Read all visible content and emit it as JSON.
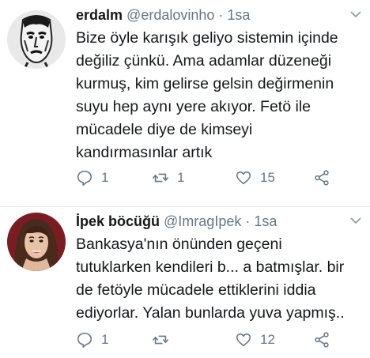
{
  "tweets": [
    {
      "display_name": "erdalm",
      "handle": "@erdalovinho",
      "separator": "·",
      "time": "1sa",
      "text": "Bize öyle karışık geliyo sistemin içinde\ndeğiliz çünkü. Ama adamlar düzeneği\nkurmuş, kim gelirse gelsin değirmenin\nsuyu hep aynı yere akıyor. Fetö ile\nmücadele diye de kimseyi\nkandırmasınlar artık",
      "replies": "1",
      "retweets": "1",
      "likes": "15"
    },
    {
      "display_name": "İpek böcüğü",
      "handle": "@ImragIpek",
      "separator": "·",
      "time": "1sa",
      "text": "Bankasya'nın önünden geçeni\ntutuklarken kendileri b... a batmışlar.  bir\nde fetöyle mücadele ettiklerini iddia\nediyorlar. Yalan bunlarda yuva yapmış..",
      "replies": "1",
      "retweets": "",
      "likes": "12"
    }
  ],
  "icons": {
    "reply": "reply-icon",
    "retweet": "retweet-icon",
    "like": "heart-icon",
    "share": "share-icon",
    "caret": "chevron-down-icon"
  },
  "colors": {
    "text": "#14171a",
    "muted": "#657786",
    "divider": "#e6ecf0"
  }
}
